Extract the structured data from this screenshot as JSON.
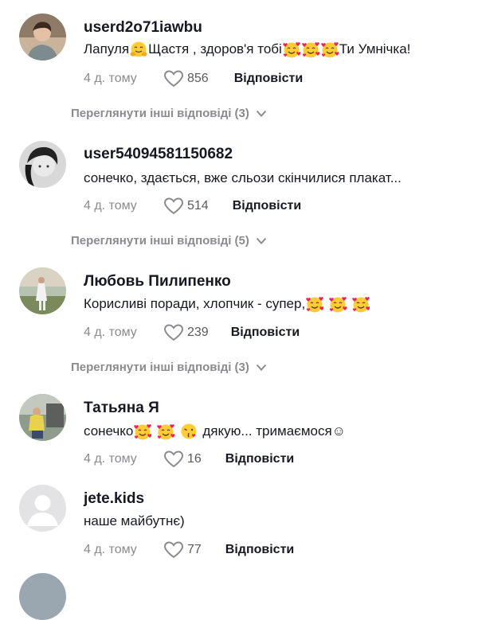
{
  "comments": [
    {
      "username": "userd2o71iawbu",
      "text_before": "Лапуля ",
      "text_mid": "Щастя , здоров'я тобі",
      "text_after": "Ти Умнічка!",
      "time": "4 д. тому",
      "likes": "856",
      "reply": "Відповісти",
      "view_replies": "Переглянути інші відповіді (3)"
    },
    {
      "username": "user54094581150682",
      "text": "сонечко, здається, вже сльози скінчилися плакат...",
      "time": "4 д. тому",
      "likes": "514",
      "reply": "Відповісти",
      "view_replies": "Переглянути інші відповіді (5)"
    },
    {
      "username": "Любовь Пилипенко",
      "text": "Корисливі поради, хлопчик - супер,",
      "time": "4 д. тому",
      "likes": "239",
      "reply": "Відповісти",
      "view_replies": "Переглянути інші відповіді (3)"
    },
    {
      "username": "Татьяна Я",
      "text_before": "сонечко",
      "text_after": "дякую... тримаємося☺",
      "time": "4 д. тому",
      "likes": "16",
      "reply": "Відповісти"
    },
    {
      "username": "jete.kids",
      "text": "наше майбутнє)",
      "time": "4 д. тому",
      "likes": "77",
      "reply": "Відповісти"
    }
  ],
  "icons": {
    "like": "heart-outline-icon",
    "expand": "chevron-down-icon",
    "emoji_hug": "hugging-face-emoji",
    "emoji_hearts": "smiling-face-with-hearts-emoji",
    "emoji_kiss": "face-blowing-kiss-emoji"
  },
  "colors": {
    "text": "#161823",
    "muted": "#8a8b91"
  }
}
